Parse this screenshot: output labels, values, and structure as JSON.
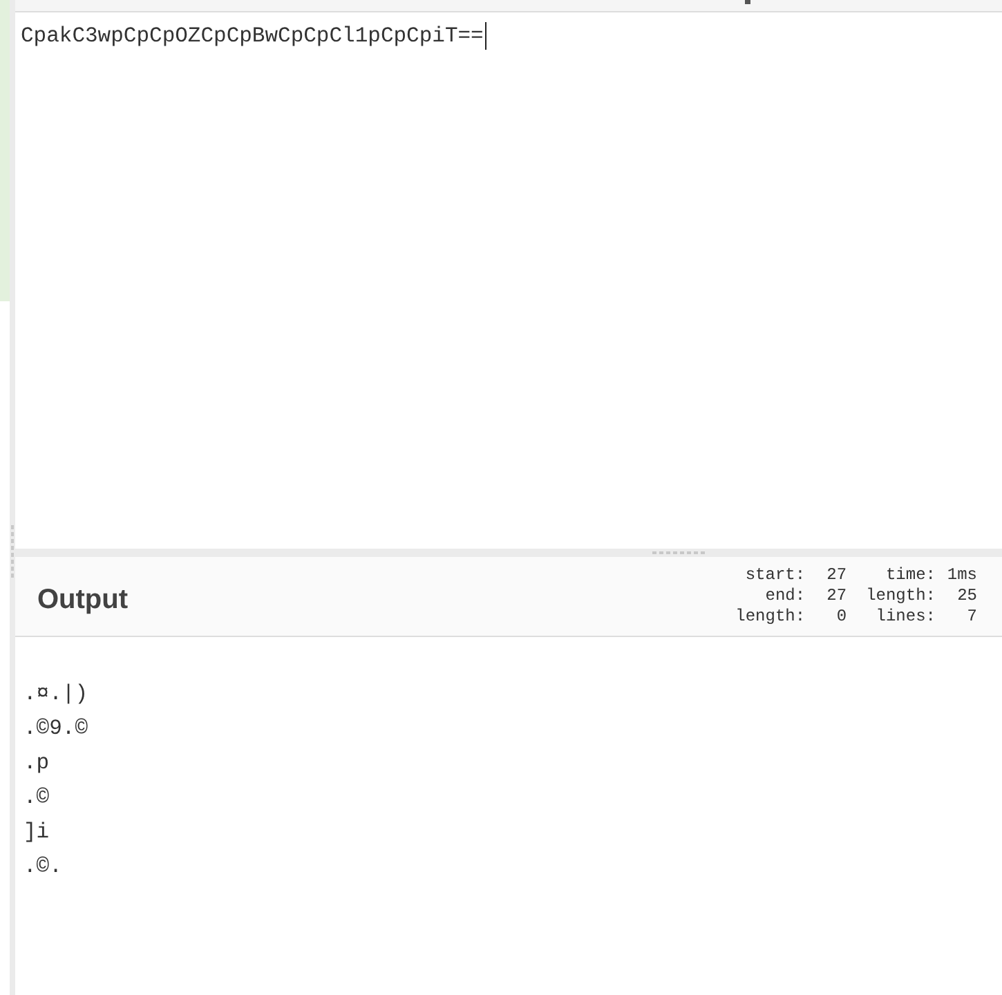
{
  "input": {
    "value": "CpakC3wpCpCpOZCpCpBwCpCpCl1pCpCpiT=="
  },
  "output": {
    "title": "Output",
    "selection_stats": [
      {
        "label": "start:",
        "value": "27"
      },
      {
        "label": "end:",
        "value": "27"
      },
      {
        "label": "length:",
        "value": "0"
      }
    ],
    "output_stats": [
      {
        "label": "time:",
        "value": "1ms"
      },
      {
        "label": "length:",
        "value": "25"
      },
      {
        "label": "lines:",
        "value": "7"
      }
    ],
    "lines": [
      ".¤.|)",
      ".©9.©",
      ".p",
      ".©",
      "]i",
      ".©."
    ]
  }
}
